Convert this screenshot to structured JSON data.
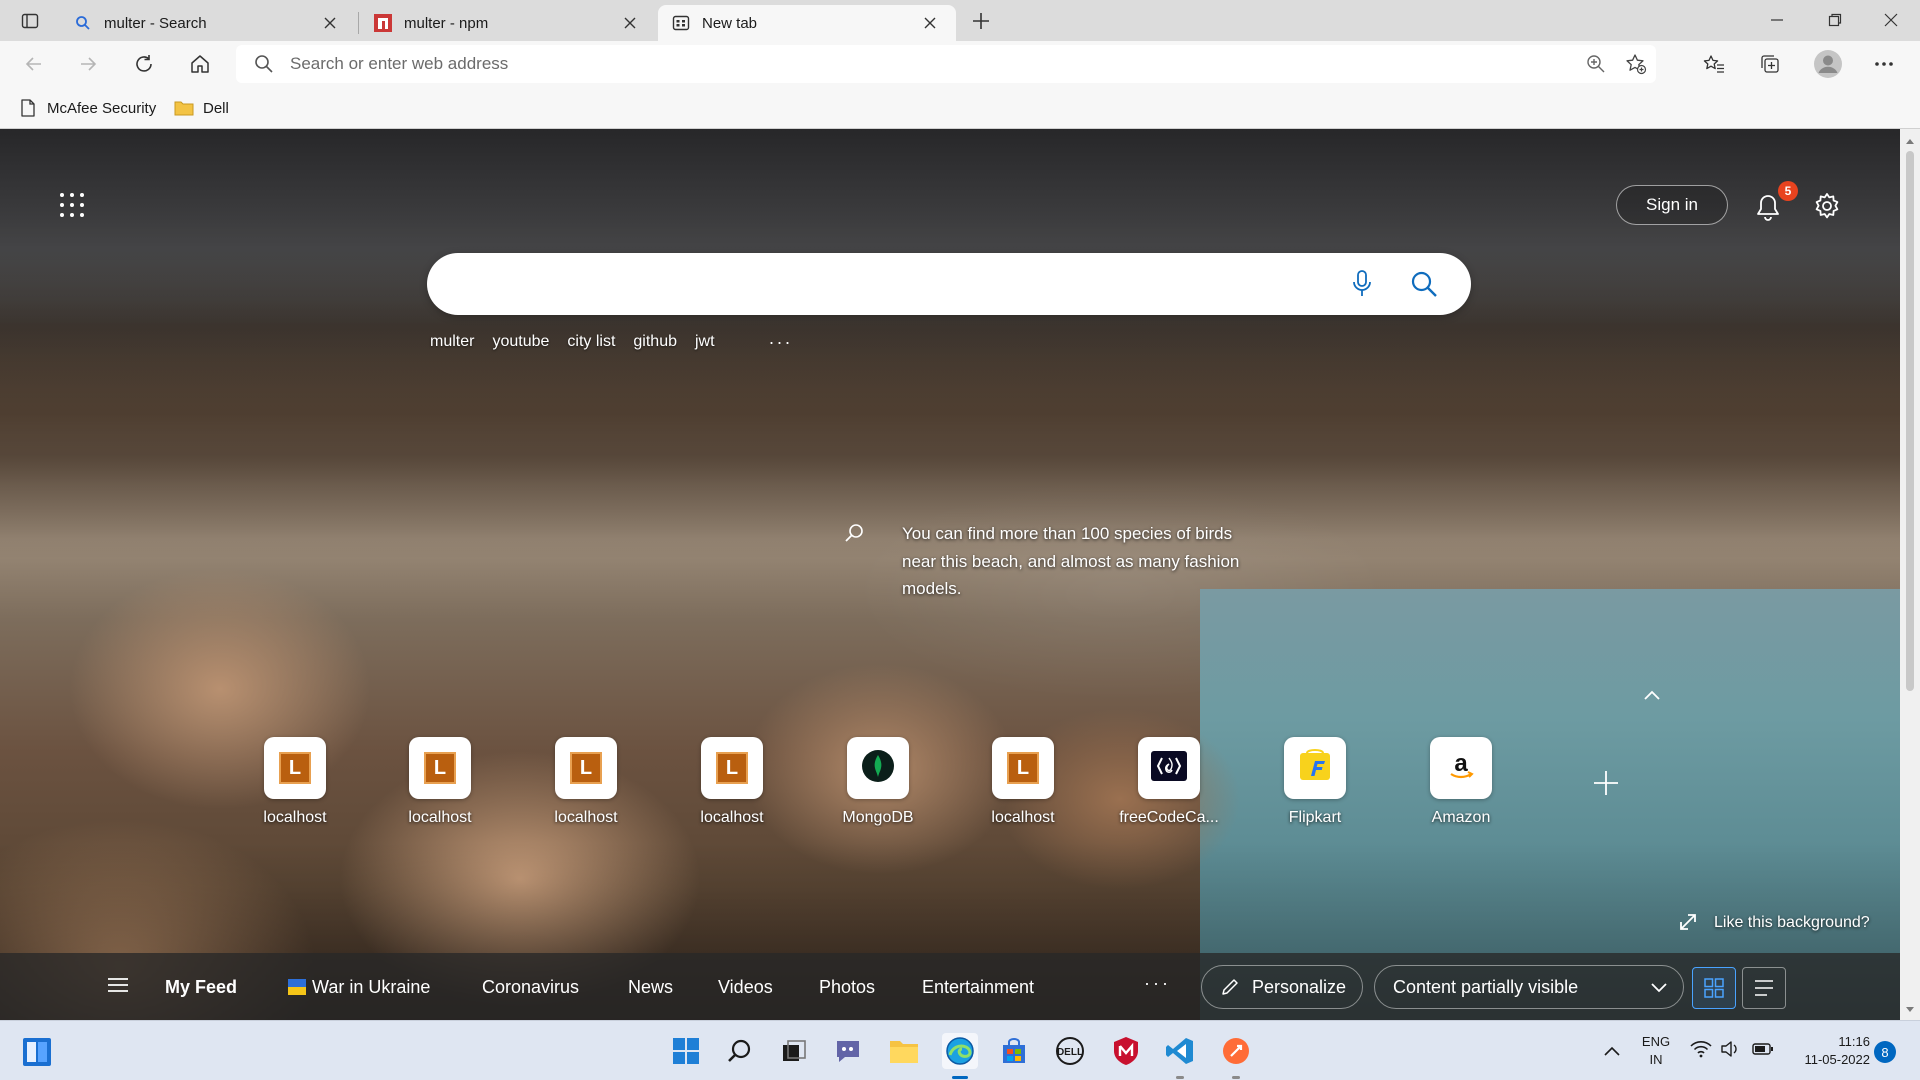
{
  "browser": {
    "tabs": [
      {
        "label": "multer - Search",
        "icon": "bing-search-icon"
      },
      {
        "label": "multer - npm",
        "icon": "npm-icon"
      },
      {
        "label": "New tab",
        "icon": "newtab-icon"
      }
    ],
    "address_placeholder": "Search or enter web address",
    "favorites": [
      {
        "label": "McAfee Security",
        "icon": "page-icon"
      },
      {
        "label": "Dell",
        "icon": "folder-icon"
      }
    ]
  },
  "ntp": {
    "signin_label": "Sign in",
    "notification_count": "5",
    "search_suggestions": [
      "multer",
      "youtube",
      "city list",
      "github",
      "jwt"
    ],
    "suggestions_more": "···",
    "fact_text": "You can find more than 100 species of birds near this beach, and almost as many fashion models.",
    "quick_links": [
      {
        "label": "localhost",
        "icon": "L"
      },
      {
        "label": "localhost",
        "icon": "L"
      },
      {
        "label": "localhost",
        "icon": "L"
      },
      {
        "label": "localhost",
        "icon": "L"
      },
      {
        "label": "MongoDB",
        "icon": "mongodb-icon"
      },
      {
        "label": "localhost",
        "icon": "L"
      },
      {
        "label": "freeCodeCa...",
        "icon": "freecodecamp-icon"
      },
      {
        "label": "Flipkart",
        "icon": "flipkart-icon"
      },
      {
        "label": "Amazon",
        "icon": "amazon-icon"
      }
    ],
    "like_background": "Like this background?",
    "feed": {
      "my_feed": "My Feed",
      "items": [
        "War in Ukraine",
        "Coronavirus",
        "News",
        "Videos",
        "Photos",
        "Entertainment"
      ],
      "more": "···",
      "personalize": "Personalize",
      "content_visibility": "Content partially visible"
    }
  },
  "taskbar": {
    "lang_top": "ENG",
    "lang_bottom": "IN",
    "time": "11:16",
    "date": "11-05-2022",
    "notif_count": "8"
  },
  "colors": {
    "accent": "#0067c0",
    "badge": "#e8431f",
    "localhost_tile": "#b95f0f"
  }
}
